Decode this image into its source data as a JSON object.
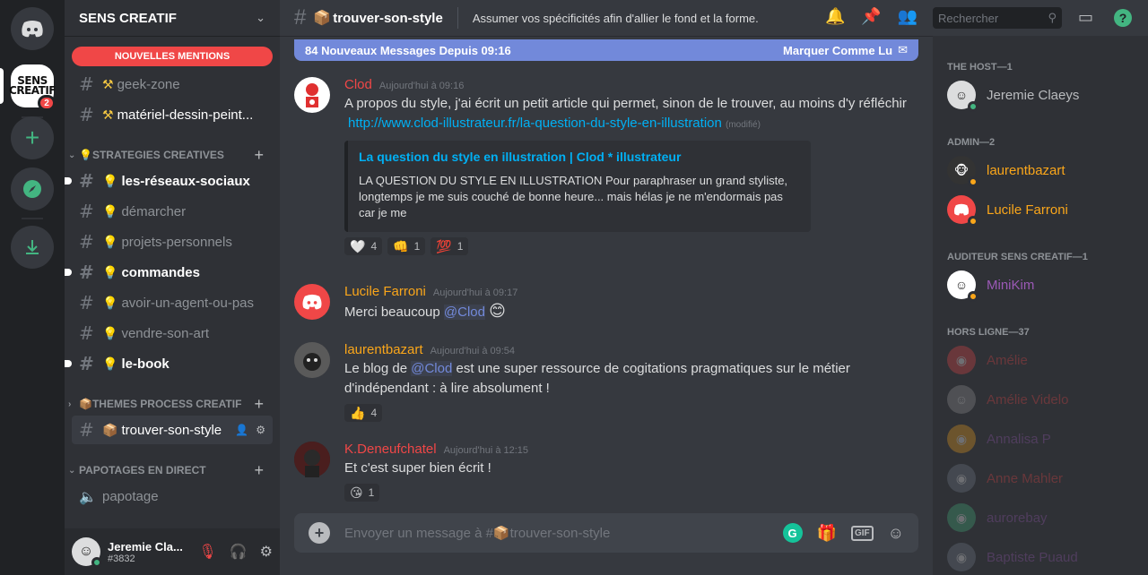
{
  "guild": {
    "name": "SENS CREATIF",
    "icon_text_big": "SENS CREATIF",
    "icon_text_small": "SENS CREATIF",
    "mention_badge": "2"
  },
  "mentions_pill": "NOUVELLES MENTIONS",
  "channels": [
    {
      "name": "geek-zone",
      "emoji": "⚒"
    },
    {
      "name": "matériel-dessin-peint...",
      "emoji": "⚒"
    },
    {
      "name": "les-réseaux-sociaux",
      "emoji": "💡"
    },
    {
      "name": "démarcher",
      "emoji": "💡"
    },
    {
      "name": "projets-personnels",
      "emoji": "💡"
    },
    {
      "name": "commandes",
      "emoji": "💡"
    },
    {
      "name": "avoir-un-agent-ou-pas",
      "emoji": "💡"
    },
    {
      "name": "vendre-son-art",
      "emoji": "💡"
    },
    {
      "name": "le-book",
      "emoji": "💡"
    },
    {
      "name": "trouver-son-style",
      "emoji": "📦"
    },
    {
      "name": "papotage"
    }
  ],
  "categories": [
    {
      "label": "STRATEGIES CREATIVES",
      "emoji": "💡"
    },
    {
      "label": "THEMES PROCESS CREATIF",
      "emoji": "📦"
    },
    {
      "label": "PAPOTAGES EN DIRECT"
    }
  ],
  "user": {
    "name": "Jeremie Cla...",
    "tag": "#3832"
  },
  "header": {
    "channel": "trouver-son-style",
    "channel_emoji": "📦",
    "topic": "Assumer vos spécificités afin d'allier le fond et la forme."
  },
  "search": {
    "placeholder": "Rechercher"
  },
  "new_messages": {
    "label": "84 Nouveaux Messages Depuis 09:16",
    "mark": "Marquer Comme Lu"
  },
  "messages": [
    {
      "author": "Clod",
      "time": "Aujourd'hui à 09:16",
      "color": "#f04747",
      "text": "A propos du style, j'ai écrit un petit article qui permet, sinon de le trouver, au moins d'y réfléchir",
      "link": "http://www.clod-illustrateur.fr/la-question-du-style-en-illustration",
      "edited": "(modifié)",
      "embed_title": "La question du style en illustration | Clod * illustrateur",
      "embed_desc": "LA QUESTION DU STYLE EN ILLUSTRATION Pour paraphraser un grand styliste, longtemps je me suis couché de bonne heure... mais hélas je ne m'endormais pas car je me",
      "reactions": [
        {
          "emoji": "🤍",
          "count": "4"
        },
        {
          "emoji": "👊",
          "count": "1"
        },
        {
          "emoji": "💯",
          "count": "1"
        }
      ]
    },
    {
      "author": "Lucile Farroni",
      "time": "Aujourd'hui à 09:17",
      "color": "#faa61a",
      "text": "Merci beaucoup",
      "mention": "@Clod",
      "emoji": "😊"
    },
    {
      "author": "laurentbazart",
      "time": "Aujourd'hui à 09:54",
      "color": "#faa61a",
      "text_before": "Le blog de",
      "mention": "@Clod",
      "text_after": "est une super ressource de cogitations pragmatiques sur le métier d'indépendant : à lire absolument !",
      "reactions": [
        {
          "emoji": "👍",
          "count": "4"
        }
      ]
    },
    {
      "author": "K.Deneufchatel",
      "time": "Aujourd'hui à 12:15",
      "color": "#f04747",
      "text": "Et c'est super bien écrit !",
      "reactions": [
        {
          "emoji": "😘",
          "count": "1"
        }
      ]
    }
  ],
  "composer": {
    "placeholder": "Envoyer un message à #📦trouver-son-style"
  },
  "member_groups": [
    {
      "label": "THE HOST—1",
      "members": [
        {
          "name": "Jeremie Claeys",
          "color": "#b9bbbe"
        }
      ]
    },
    {
      "label": "ADMIN—2",
      "members": [
        {
          "name": "laurentbazart",
          "color": "#faa61a"
        },
        {
          "name": "Lucile Farroni",
          "color": "#faa61a"
        }
      ]
    },
    {
      "label": "AUDITEUR SENS CREATIF—1",
      "members": [
        {
          "name": "MiniKim",
          "color": "#9b59b6"
        }
      ]
    },
    {
      "label": "HORS LIGNE—37",
      "members": [
        {
          "name": "Amélie",
          "color": "#f04747"
        },
        {
          "name": "Amélie Videlo",
          "color": "#f04747"
        },
        {
          "name": "Annalisa P",
          "color": "#9b59b6"
        },
        {
          "name": "Anne Mahler",
          "color": "#f04747"
        },
        {
          "name": "aurorebay",
          "color": "#9b59b6"
        },
        {
          "name": "Baptiste Puaud",
          "color": "#9b59b6"
        }
      ]
    }
  ]
}
